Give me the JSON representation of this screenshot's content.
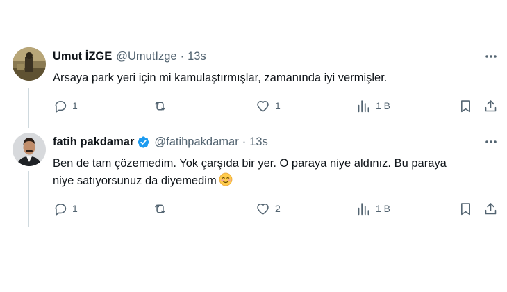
{
  "tweets": [
    {
      "display_name": "Umut İZGE",
      "handle": "@UmutIzge",
      "separator": "·",
      "time": "13s",
      "text": "Arsaya park yeri için mi kamulaştırmışlar, zamanında iyi vermişler.",
      "verified": false,
      "actions": {
        "replies": "1",
        "retweets": "",
        "likes": "1",
        "views": "1 B"
      }
    },
    {
      "display_name": "fatih pakdamar",
      "handle": "@fatihpakdamar",
      "separator": "·",
      "time": "13s",
      "text_line1": "Ben de tam çözemedim. Yok çarşıda bir yer. O paraya niye aldınız. Bu paraya",
      "text_line2": "niye satıyorsunuz da diyemedim",
      "emoji": "smiling-face-emoji",
      "verified": true,
      "actions": {
        "replies": "1",
        "retweets": "",
        "likes": "2",
        "views": "1 B"
      }
    }
  ],
  "icons": {
    "reply": "reply-icon",
    "retweet": "retweet-icon",
    "like": "like-icon",
    "views": "views-icon",
    "bookmark": "bookmark-icon",
    "share": "share-icon",
    "more": "more-icon",
    "verified": "verified-badge-icon"
  },
  "colors": {
    "verified": "#1d9bf0",
    "muted": "#536471",
    "thread_line": "#cfd9de"
  }
}
